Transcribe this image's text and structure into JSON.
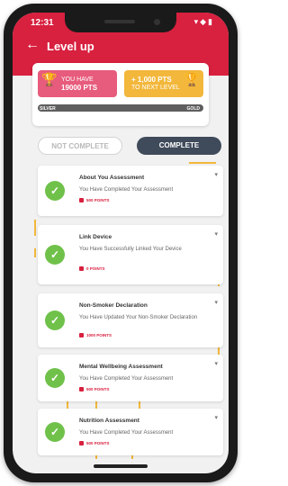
{
  "status_bar": {
    "time": "12:31",
    "icons": "▾◆▮"
  },
  "header": {
    "title": "Level up"
  },
  "points": {
    "current_label": "YOU HAVE",
    "current_value": "19000 PTS",
    "next_value": "+ 1,000 PTS",
    "next_label": "TO NEXT LEVEL",
    "level_from": "SILVER",
    "level_to": "GOLD"
  },
  "filters": {
    "incomplete": "NOT COMPLETE",
    "complete": "COMPLETE",
    "selected": "COMPLETE"
  },
  "tasks": [
    {
      "title": "About You Assessment",
      "desc": "You Have Completed Your Assessment",
      "points": "500 POINTS"
    },
    {
      "title": "Link Device",
      "desc": "You Have Successfully Linked Your Device",
      "points": "0 POINTS"
    },
    {
      "title": "Non-Smoker Declaration",
      "desc": "You Have Updated Your Non-Smoker Declaration",
      "points": "1000 POINTS"
    },
    {
      "title": "Mental Wellbeing Assessment",
      "desc": "You Have Completed Your Assessment",
      "points": "500 POINTS"
    },
    {
      "title": "Nutrition Assessment",
      "desc": "You Have Completed Your Assessment",
      "points": "500 POINTS"
    }
  ],
  "colors": {
    "brand": "#d8203f",
    "done": "#6fc14a",
    "gold": "#f2b73b",
    "active_toggle": "#3f4a5a"
  }
}
